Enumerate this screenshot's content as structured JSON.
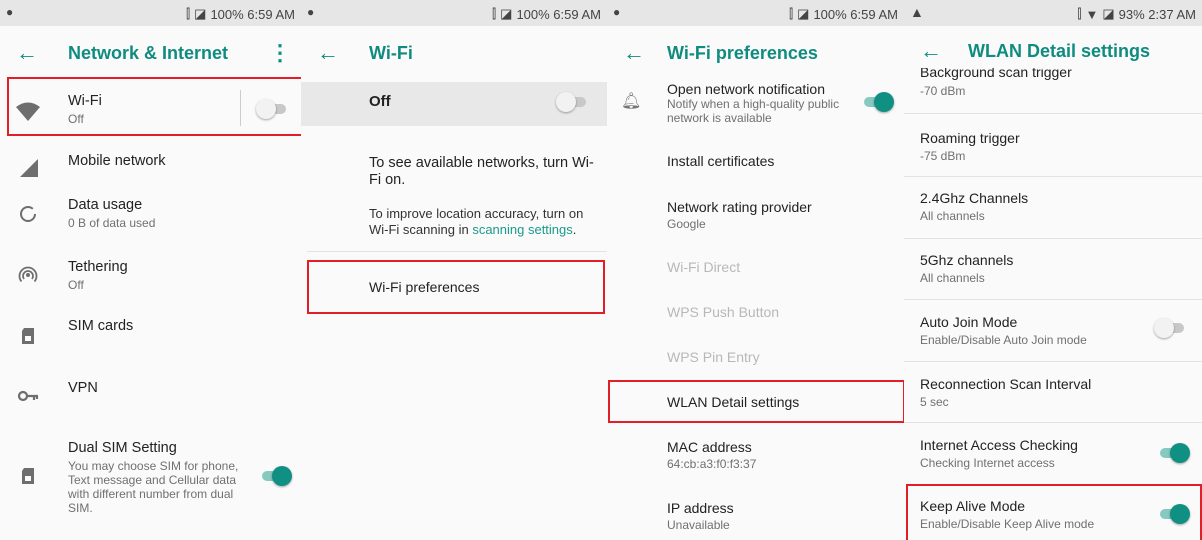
{
  "colors": {
    "accent": "#0f8c80",
    "highlight": "#e21e26"
  },
  "panel1": {
    "status": {
      "right": "100%  6:59 AM"
    },
    "title": "Network & Internet",
    "items": [
      {
        "label": "Wi-Fi",
        "sub": "Off",
        "icon": "wifi-icon"
      },
      {
        "label": "Mobile network",
        "icon": "signal-icon"
      },
      {
        "label": "Data usage",
        "sub": "0 B of data used",
        "icon": "data-usage-icon"
      },
      {
        "label": "Tethering",
        "sub": "Off",
        "icon": "hotspot-icon"
      },
      {
        "label": "SIM cards",
        "icon": "sim-icon"
      },
      {
        "label": "VPN",
        "icon": "key-icon"
      },
      {
        "label": "Dual SIM Setting",
        "sub": "You may choose SIM for phone, Text message and Cellular data with different number from dual SIM.",
        "icon": "sim-icon"
      }
    ]
  },
  "panel2": {
    "status": {
      "right": "100%  6:59 AM"
    },
    "title": "Wi-Fi",
    "master": "Off",
    "msg1": "To see available networks, turn Wi-Fi on.",
    "msg2_pre": "To improve location accuracy, turn on Wi-Fi scanning in ",
    "msg2_link": "scanning settings",
    "msg2_post": ".",
    "pref": "Wi-Fi preferences"
  },
  "panel3": {
    "status": {
      "right": "100%  6:59 AM"
    },
    "title": "Wi-Fi preferences",
    "items": [
      {
        "label": "Open network notification",
        "sub": "Notify when a high-quality public network is available"
      },
      {
        "label": "Install certificates"
      },
      {
        "label": "Network rating provider",
        "sub": "Google"
      },
      {
        "label": "Wi-Fi Direct"
      },
      {
        "label": "WPS Push Button"
      },
      {
        "label": "WPS Pin Entry"
      },
      {
        "label": "WLAN Detail settings"
      },
      {
        "label": "MAC address",
        "sub": "64:cb:a3:f0:f3:37"
      },
      {
        "label": "IP address",
        "sub": "Unavailable"
      }
    ]
  },
  "panel4": {
    "status": {
      "right": "93%  2:37 AM"
    },
    "title": "WLAN Detail settings",
    "items": [
      {
        "label": "Background scan trigger",
        "sub": "-70 dBm"
      },
      {
        "label": "Roaming trigger",
        "sub": "-75 dBm"
      },
      {
        "label": "2.4Ghz Channels",
        "sub": "All channels"
      },
      {
        "label": "5Ghz channels",
        "sub": "All channels"
      },
      {
        "label": "Auto Join Mode",
        "sub": "Enable/Disable Auto Join mode"
      },
      {
        "label": "Reconnection Scan Interval",
        "sub": "5 sec"
      },
      {
        "label": "Internet Access Checking",
        "sub": "Checking Internet access"
      },
      {
        "label": "Keep Alive Mode",
        "sub": "Enable/Disable Keep Alive mode"
      }
    ]
  }
}
